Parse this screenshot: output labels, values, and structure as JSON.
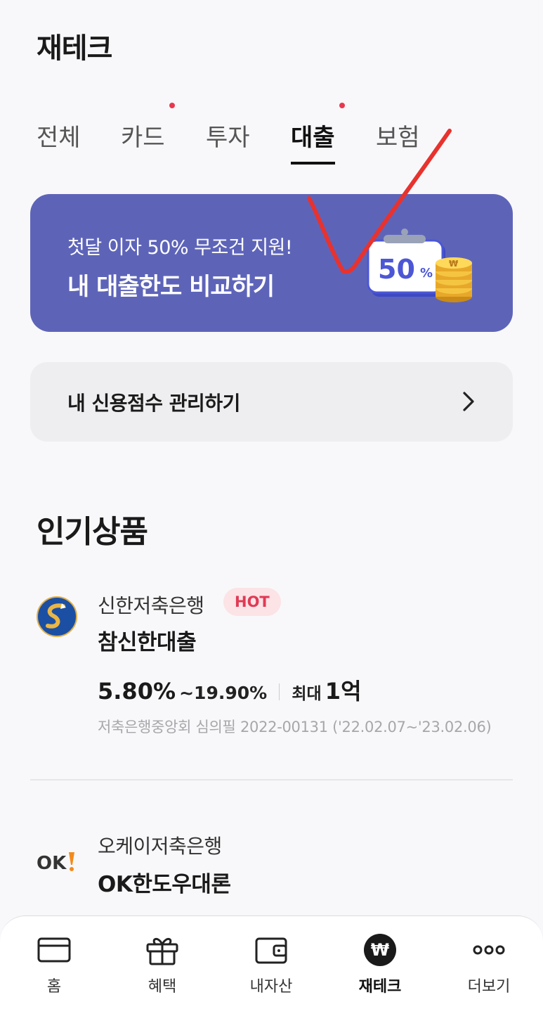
{
  "header": {
    "title": "재테크"
  },
  "tabs": [
    {
      "label": "전체",
      "active": false,
      "dot": false
    },
    {
      "label": "카드",
      "active": false,
      "dot": true
    },
    {
      "label": "투자",
      "active": false,
      "dot": false
    },
    {
      "label": "대출",
      "active": true,
      "dot": true
    },
    {
      "label": "보험",
      "active": false,
      "dot": false
    }
  ],
  "promo": {
    "subtitle": "첫달 이자 50% 무조건 지원!",
    "title": "내 대출한도 비교하기",
    "badge_value": "50",
    "badge_unit": "%",
    "coin_symbol": "₩",
    "color": "#5d64b8"
  },
  "credit": {
    "label": "내 신용점수 관리하기"
  },
  "popular": {
    "title": "인기상품",
    "products": [
      {
        "bank": "신한저축은행",
        "badge": "HOT",
        "name": "참신한대출",
        "rate_min": "5.80%",
        "rate_max": "~19.90%",
        "limit_label": "최대",
        "limit_value": "1억",
        "disclaimer": "저축은행중앙회 심의필 2022-00131 ('22.02.07~'23.02.06)"
      },
      {
        "bank": "오케이저축은행",
        "name": "OK한도우대론",
        "logo_text": "OK"
      }
    ]
  },
  "bottom_nav": [
    {
      "label": "홈",
      "icon": "card-icon",
      "active": false
    },
    {
      "label": "혜택",
      "icon": "gift-icon",
      "active": false
    },
    {
      "label": "내자산",
      "icon": "wallet-icon",
      "active": false
    },
    {
      "label": "재테크",
      "icon": "won-icon",
      "active": true
    },
    {
      "label": "더보기",
      "icon": "more-icon",
      "active": false
    }
  ],
  "colors": {
    "accent_red": "#e8384f",
    "hot_badge_bg": "#fbe3e6",
    "hot_badge_text": "#e03a55",
    "annotation": "#e8322e"
  }
}
